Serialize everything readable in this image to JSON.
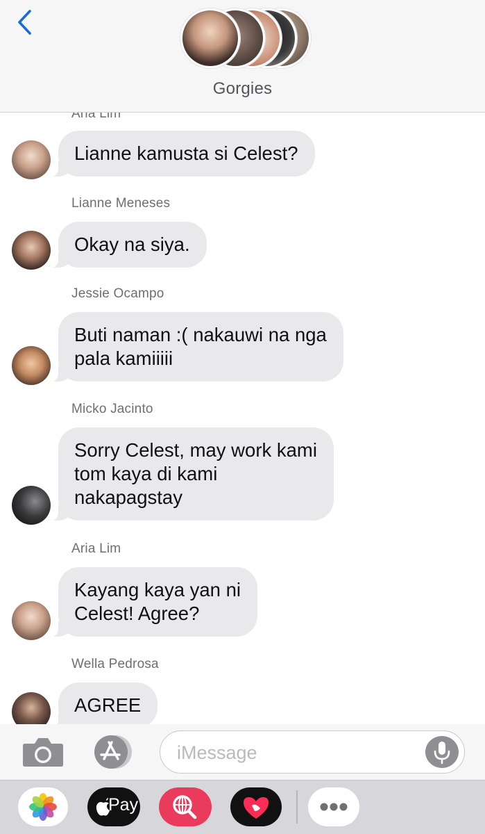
{
  "header": {
    "back_icon": "chevron-left-icon",
    "group_name": "Gorgies"
  },
  "thread": {
    "partial_top_sender": "Aria Lim",
    "messages": [
      {
        "sender": "Aria Lim",
        "lines": [
          "Lianne kamusta si Celest?"
        ],
        "avatar_color": "#b8a39a"
      },
      {
        "sender": "Lianne Meneses",
        "lines": [
          "Okay na siya."
        ],
        "avatar_color": "#6b5248"
      },
      {
        "sender": "Jessie Ocampo",
        "lines": [
          "Buti naman :( nakauwi na nga",
          "pala kamiiiii"
        ],
        "avatar_color": "#c6906c"
      },
      {
        "sender": "Micko Jacinto",
        "lines": [
          "Sorry Celest, may work kami",
          "tom kaya di kami",
          "nakapagstay"
        ],
        "avatar_color": "#2c2c2e"
      },
      {
        "sender": "Aria Lim",
        "lines": [
          "Kayang kaya yan ni",
          "Celest! Agree?"
        ],
        "avatar_color": "#b8a39a"
      },
      {
        "sender": "Wella Pedrosa",
        "lines": [
          "AGREE"
        ],
        "avatar_color": "#5a4a44"
      }
    ]
  },
  "composer": {
    "camera_icon": "camera-icon",
    "appstore_icon": "app-store-icon",
    "placeholder": "iMessage",
    "mic_icon": "microphone-icon"
  },
  "app_drawer": {
    "apps": [
      {
        "name": "photos-app-icon"
      },
      {
        "name": "apple-pay-app-icon",
        "label": "Pay"
      },
      {
        "name": "image-search-app-icon"
      },
      {
        "name": "digital-touch-app-icon"
      },
      {
        "name": "more-apps-icon"
      }
    ]
  },
  "colors": {
    "bubble": "#e9e9eb",
    "link_blue": "#1a6bd6",
    "search_app": "#ea3b5d"
  }
}
